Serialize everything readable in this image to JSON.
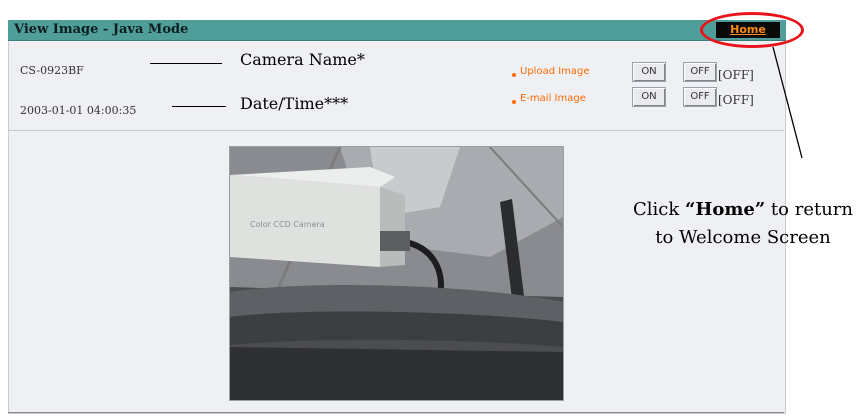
{
  "window": {
    "title": "View Image - Java Mode"
  },
  "header": {
    "home_label": "Home"
  },
  "camera": {
    "name": "CS-0923BF",
    "datetime": "2003-01-01 04:00:35"
  },
  "annotations": {
    "camera_name": "Camera  Name*",
    "datetime": "Date/Time***",
    "home_hint_prefix": "Click ",
    "home_hint_bold": "“Home”",
    "home_hint_suffix": " to return to Welcome Screen"
  },
  "controls": {
    "upload": {
      "label": "Upload Image",
      "on_label": "ON",
      "off_label": "OFF",
      "status": "[OFF]"
    },
    "email": {
      "label": "E-mail Image",
      "on_label": "ON",
      "off_label": "OFF",
      "status": "[OFF]"
    }
  },
  "image": {
    "embedded_label": "Color CCD Camera"
  },
  "colors": {
    "accent": "#4f9e9a",
    "link": "#ff6a00",
    "highlight": "#e8141a"
  }
}
